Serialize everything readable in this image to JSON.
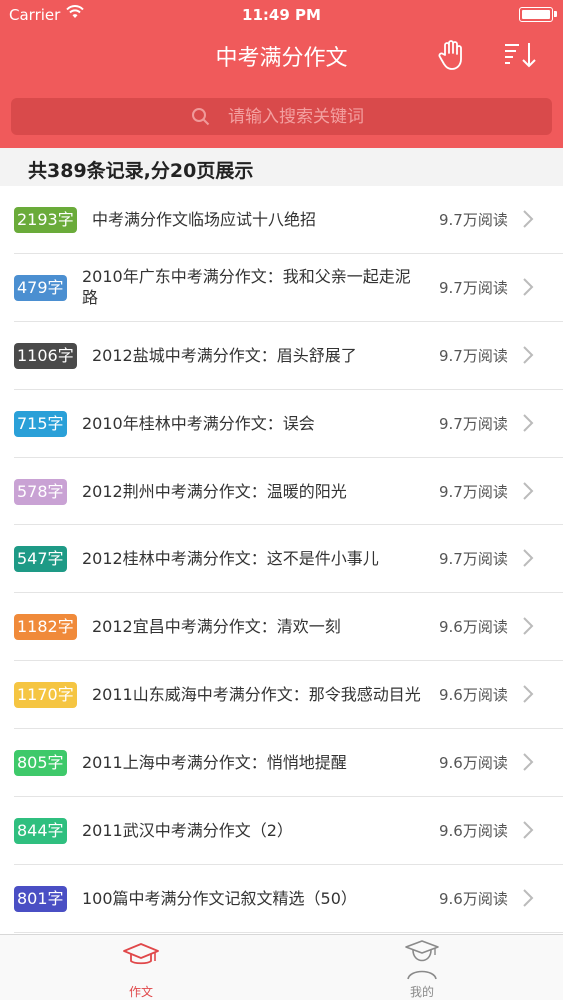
{
  "status": {
    "carrier": "Carrier",
    "time": "11:49 PM"
  },
  "nav": {
    "title": "中考满分作文",
    "icons": [
      "hand-icon",
      "sort-icon"
    ]
  },
  "search": {
    "placeholder": "请输入搜索关键词"
  },
  "summary": "共389条记录,分20页展示",
  "articles": [
    {
      "words": "2193字",
      "title": "中考满分作文临场应试十八绝招",
      "views": "9.7万阅读",
      "color": "#6aab3a"
    },
    {
      "words": "479字",
      "title": "2010年广东中考满分作文：我和父亲一起走泥路",
      "views": "9.7万阅读",
      "color": "#4b8fd1"
    },
    {
      "words": "1106字",
      "title": "2012盐城中考满分作文：眉头舒展了",
      "views": "9.7万阅读",
      "color": "#4a4a4a"
    },
    {
      "words": "715字",
      "title": "2010年桂林中考满分作文：误会",
      "views": "9.7万阅读",
      "color": "#2aa0d8"
    },
    {
      "words": "578字",
      "title": "2012荆州中考满分作文：温暖的阳光",
      "views": "9.7万阅读",
      "color": "#c9a2d4"
    },
    {
      "words": "547字",
      "title": "2012桂林中考满分作文：这不是件小事儿",
      "views": "9.7万阅读",
      "color": "#1e9a86"
    },
    {
      "words": "1182字",
      "title": "2012宜昌中考满分作文：清欢一刻",
      "views": "9.6万阅读",
      "color": "#f08a3a"
    },
    {
      "words": "1170字",
      "title": "2011山东威海中考满分作文：那令我感动目光",
      "views": "9.6万阅读",
      "color": "#f5c542"
    },
    {
      "words": "805字",
      "title": "2011上海中考满分作文：悄悄地提醒",
      "views": "9.6万阅读",
      "color": "#3ec96a"
    },
    {
      "words": "844字",
      "title": "2011武汉中考满分作文（2）",
      "views": "9.6万阅读",
      "color": "#2fbf7f"
    },
    {
      "words": "801字",
      "title": "100篇中考满分作文记叙文精选（50）",
      "views": "9.6万阅读",
      "color": "#4a4fc4"
    }
  ],
  "tabs": [
    {
      "label": "作文",
      "icon": "graduation-cap-icon",
      "active": true
    },
    {
      "label": "我的",
      "icon": "user-profile-icon",
      "active": false
    }
  ],
  "colors": {
    "header": "#f05a5b",
    "active_tab": "#e0484a",
    "inactive_tab": "#8a8a8a"
  }
}
